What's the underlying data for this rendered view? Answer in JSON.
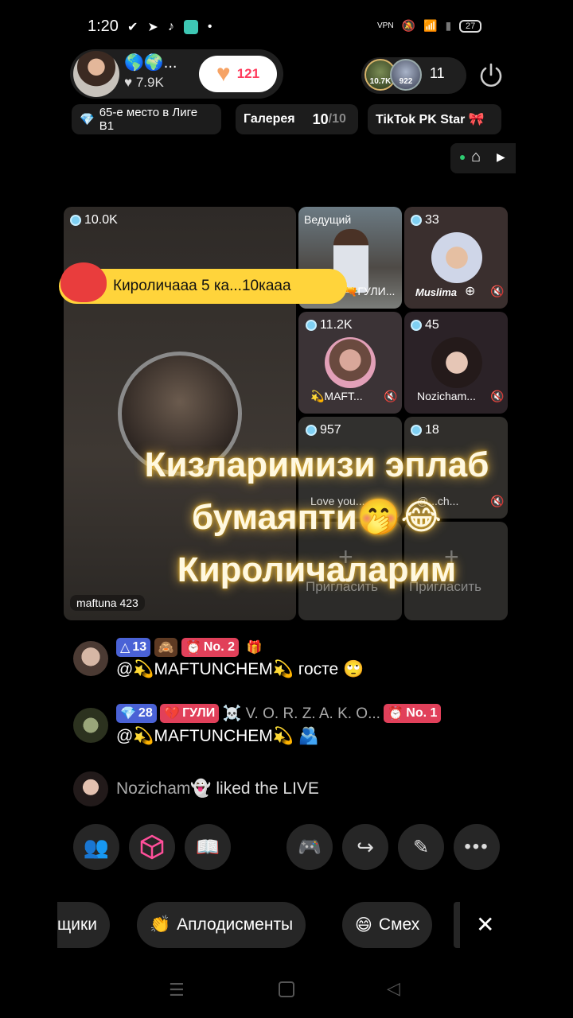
{
  "status_bar": {
    "time": "1:20",
    "icons": [
      "check-icon",
      "telegram-icon",
      "tiktok-icon",
      "app-icon",
      "dot-icon"
    ],
    "vpn": "VPN",
    "battery": "27"
  },
  "host": {
    "globes": "🌎🌍...",
    "likes": "♥ 7.9K",
    "heart_count": "121"
  },
  "viewers": {
    "badge1": "10.7K",
    "badge2": "922",
    "count": "11"
  },
  "pills": {
    "rank": "65-е место в Лиге B1",
    "gallery_label": "Галерея",
    "gallery_count": "10",
    "gallery_total": "/10",
    "pk": "TikTok PK Star 🎀"
  },
  "grid": {
    "main": {
      "score": "10.0K",
      "name": "maftuna 423"
    },
    "banner": "Кироличааа 5 ка...10каaa",
    "cells": [
      {
        "label": "Ведущий",
        "name": "🔫ГУЛИ..."
      },
      {
        "score": "33",
        "name": "Muslima"
      },
      {
        "score": "11.2K",
        "name": "💫MAFT..."
      },
      {
        "score": "45",
        "name": "Nozicham..."
      },
      {
        "score": "957",
        "name": "Love you..."
      },
      {
        "score": "18",
        "name": "@...ch..."
      },
      {
        "name": "Пригласить"
      },
      {
        "name": "Пригласить"
      }
    ]
  },
  "overlay": {
    "line1": "Кизларимизи эплаб",
    "line2": "бумаяпти🤭😂",
    "line3": "Кироличаларим"
  },
  "comments": [
    {
      "badges": [
        "13",
        "🙈",
        "No. 2",
        "🎁"
      ],
      "text": "@💫MAFTUNCHEM💫 госте 🙄"
    },
    {
      "badges": [
        "28",
        "ГУЛИ",
        "☠️ V. O. R. Z. A. K. O...",
        "No. 1"
      ],
      "text": "@💫MAFTUNCHEM💫 🫂"
    },
    {
      "user": "Nozicham👻",
      "text": "liked the LIVE"
    }
  ],
  "chips": {
    "left": "щики",
    "applause": "Аплодисменты",
    "laugh": "Смех"
  }
}
